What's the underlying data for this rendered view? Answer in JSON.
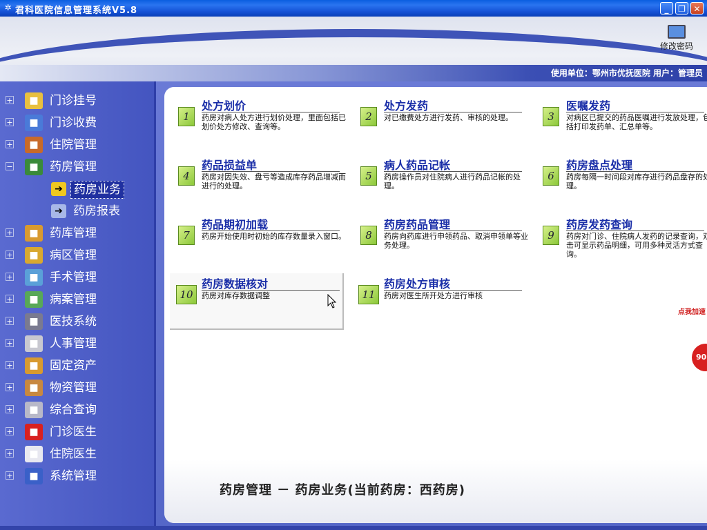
{
  "window": {
    "title": "君科医院信息管理系统V5.8",
    "btn_min": "_",
    "btn_max": "❐",
    "btn_close": "✕"
  },
  "header": {
    "change_password_label": "修改密码",
    "unit_info": "使用单位：鄂州市优抚医院    用户：管理员"
  },
  "sidebar": {
    "items": [
      {
        "label": "门诊挂号",
        "icon": "registration-icon",
        "expander": "+",
        "color": "#e8c040"
      },
      {
        "label": "门诊收费",
        "icon": "calculator-icon",
        "expander": "+",
        "color": "#4a7ad8"
      },
      {
        "label": "住院管理",
        "icon": "ward-icon",
        "expander": "+",
        "color": "#c86a2a"
      },
      {
        "label": "药房管理",
        "icon": "pharmacy-icon",
        "expander": "−",
        "color": "#3a8a3a"
      },
      {
        "label": "药库管理",
        "icon": "warehouse-icon",
        "expander": "+",
        "color": "#d89a30"
      },
      {
        "label": "病区管理",
        "icon": "area-icon",
        "expander": "+",
        "color": "#d8a830"
      },
      {
        "label": "手术管理",
        "icon": "surgery-icon",
        "expander": "+",
        "color": "#5aa0d8"
      },
      {
        "label": "病案管理",
        "icon": "records-icon",
        "expander": "+",
        "color": "#58a858"
      },
      {
        "label": "医技系统",
        "icon": "tech-icon",
        "expander": "+",
        "color": "#7a7a90"
      },
      {
        "label": "人事管理",
        "icon": "personnel-icon",
        "expander": "+",
        "color": "#c8c8d0"
      },
      {
        "label": "固定资产",
        "icon": "assets-icon",
        "expander": "+",
        "color": "#d89a30"
      },
      {
        "label": "物资管理",
        "icon": "materials-icon",
        "expander": "+",
        "color": "#c88840"
      },
      {
        "label": "综合查询",
        "icon": "query-icon",
        "expander": "+",
        "color": "#b8b8c8"
      },
      {
        "label": "门诊医生",
        "icon": "doctor-icon",
        "expander": "+",
        "color": "#d82020"
      },
      {
        "label": "住院医生",
        "icon": "inpatient-doctor-icon",
        "expander": "+",
        "color": "#e8e8f0"
      },
      {
        "label": "系统管理",
        "icon": "system-icon",
        "expander": "+",
        "color": "#3a60c8"
      }
    ],
    "subitems": [
      {
        "label": "药房业务",
        "icon": "arrow-right-icon",
        "color": "#f0c820"
      },
      {
        "label": "药房报表",
        "icon": "report-icon",
        "color": "#a8b8e8"
      }
    ]
  },
  "functions": [
    {
      "num": "1",
      "name": "处方划价",
      "desc": "药房对病人处方进行划价处理，里面包括已划价处方修改、查询等。"
    },
    {
      "num": "2",
      "name": "处方发药",
      "desc": "对已缴费处方进行发药、审核的处理。"
    },
    {
      "num": "3",
      "name": "医嘱发药",
      "desc": "对病区已提交的药品医嘱进行发放处理，包括打印发药单、汇总单等。"
    },
    {
      "num": "4",
      "name": "药品损益单",
      "desc": "药房对因失效、盘亏等造成库存药品增减而进行的处理。"
    },
    {
      "num": "5",
      "name": "病人药品记帐",
      "desc": "药房操作员对住院病人进行药品记帐的处理。"
    },
    {
      "num": "6",
      "name": "药房盘点处理",
      "desc": "药房每隔一时间段对库存进行药品盘存的处理。"
    },
    {
      "num": "7",
      "name": "药品期初加载",
      "desc": "药房开始使用时初始的库存数量录入窗口。"
    },
    {
      "num": "8",
      "name": "药房药品管理",
      "desc": "药房向药库进行申领药品、取消申领单等业务处理。"
    },
    {
      "num": "9",
      "name": "药房发药查询",
      "desc": "药房对门诊、住院病人发药的记录查询，双击可显示药品明细，可用多种灵活方式查询。"
    },
    {
      "num": "10",
      "name": "药房数据核对",
      "desc": "药房对库存数据调整"
    },
    {
      "num": "11",
      "name": "药房处方审核",
      "desc": "药房对医生所开处方进行审核"
    }
  ],
  "footer": {
    "text": "药房管理 － 药房业务(当前药房：西药房)"
  },
  "accelerator": {
    "label": "点我加速",
    "value": "90"
  }
}
